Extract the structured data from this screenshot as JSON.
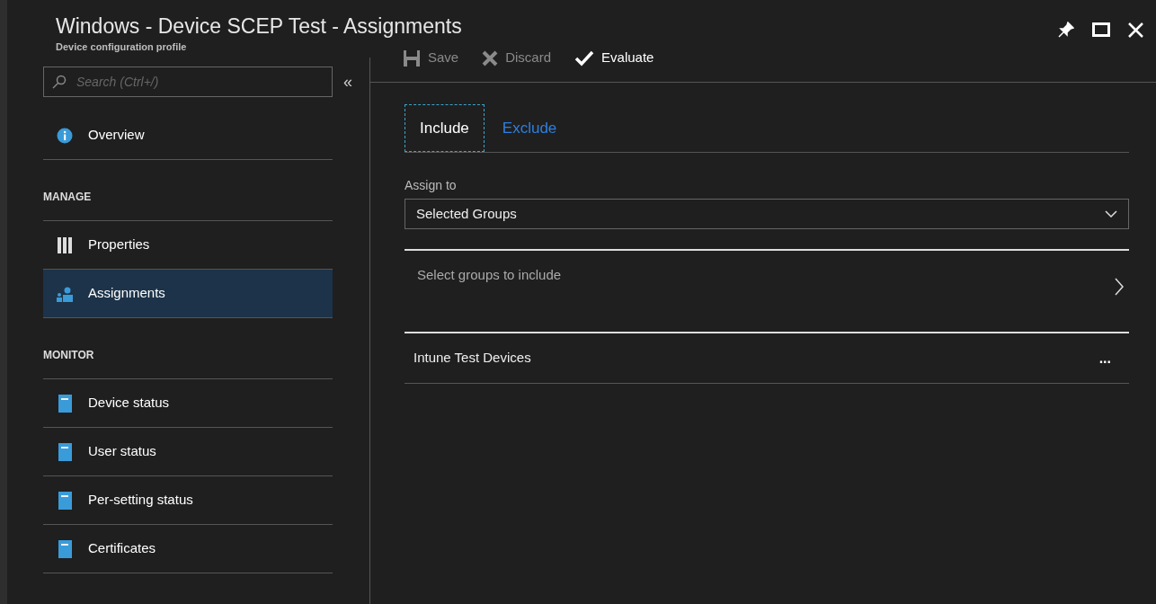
{
  "window": {
    "title": "Windows - Device SCEP Test - Assignments",
    "subtitle": "Device configuration profile"
  },
  "sidebar": {
    "search": {
      "placeholder": "Search (Ctrl+/)"
    },
    "collapse": "«",
    "items": [
      {
        "kind": "info",
        "label": "Overview",
        "selected": false
      },
      {
        "kind": "header",
        "label": "MANAGE"
      },
      {
        "kind": "columns",
        "label": "Properties",
        "selected": false
      },
      {
        "kind": "people",
        "label": "Assignments",
        "selected": true
      },
      {
        "kind": "header",
        "label": "MONITOR"
      },
      {
        "kind": "report",
        "label": "Device status",
        "selected": false
      },
      {
        "kind": "report",
        "label": "User status",
        "selected": false
      },
      {
        "kind": "report",
        "label": "Per-setting status",
        "selected": false
      },
      {
        "kind": "report",
        "label": "Certificates",
        "selected": false
      }
    ]
  },
  "toolbar": [
    {
      "kind": "save",
      "label": "Save",
      "disabled": true
    },
    {
      "kind": "discard",
      "label": "Discard",
      "disabled": true
    },
    {
      "kind": "evaluate",
      "label": "Evaluate",
      "disabled": false
    }
  ],
  "tabs": [
    {
      "label": "Include",
      "selected": true
    },
    {
      "label": "Exclude",
      "selected": false
    }
  ],
  "assign_to": {
    "label": "Assign to",
    "value": "Selected Groups"
  },
  "select_groups": {
    "label": "Select groups to include"
  },
  "groups": [
    {
      "name": "Intune Test Devices",
      "menu": "..."
    }
  ]
}
